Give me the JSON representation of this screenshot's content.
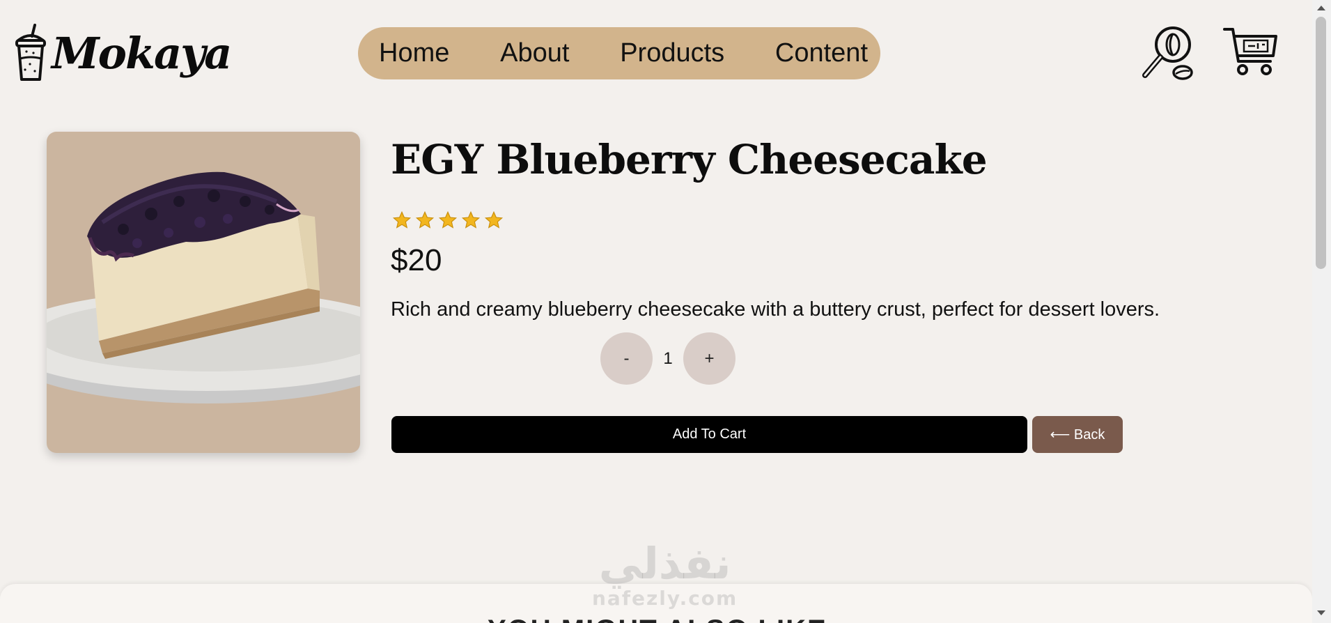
{
  "header": {
    "logo_text": "Mokaya",
    "nav": [
      {
        "label": "Home"
      },
      {
        "label": "About"
      },
      {
        "label": "Products"
      },
      {
        "label": "Content"
      }
    ],
    "icons": [
      "search-coffee-icon",
      "cart-icon"
    ]
  },
  "product": {
    "title": "EGY Blueberry Cheesecake",
    "rating": 5,
    "rating_max": 5,
    "price": "$20",
    "description": "Rich and creamy blueberry cheesecake with a buttery crust, perfect for dessert lovers.",
    "quantity": {
      "decrement_label": "-",
      "value": "1",
      "increment_label": "+"
    },
    "add_to_cart_label": "Add To Cart",
    "back_label": "⟵ Back"
  },
  "related": {
    "heading": "YOU MIGHT ALSO LIKE"
  },
  "watermark": {
    "arabic": "نفذلي",
    "latin": "nafezly.com"
  },
  "colors": {
    "background": "#f3f0ed",
    "nav_background": "#d2b48c",
    "image_background": "#cbb59f",
    "add_to_cart_bg": "#000000",
    "back_bg": "#7a5a4c",
    "qty_button_bg": "#d9cdc8",
    "star": "#f2b61f"
  }
}
